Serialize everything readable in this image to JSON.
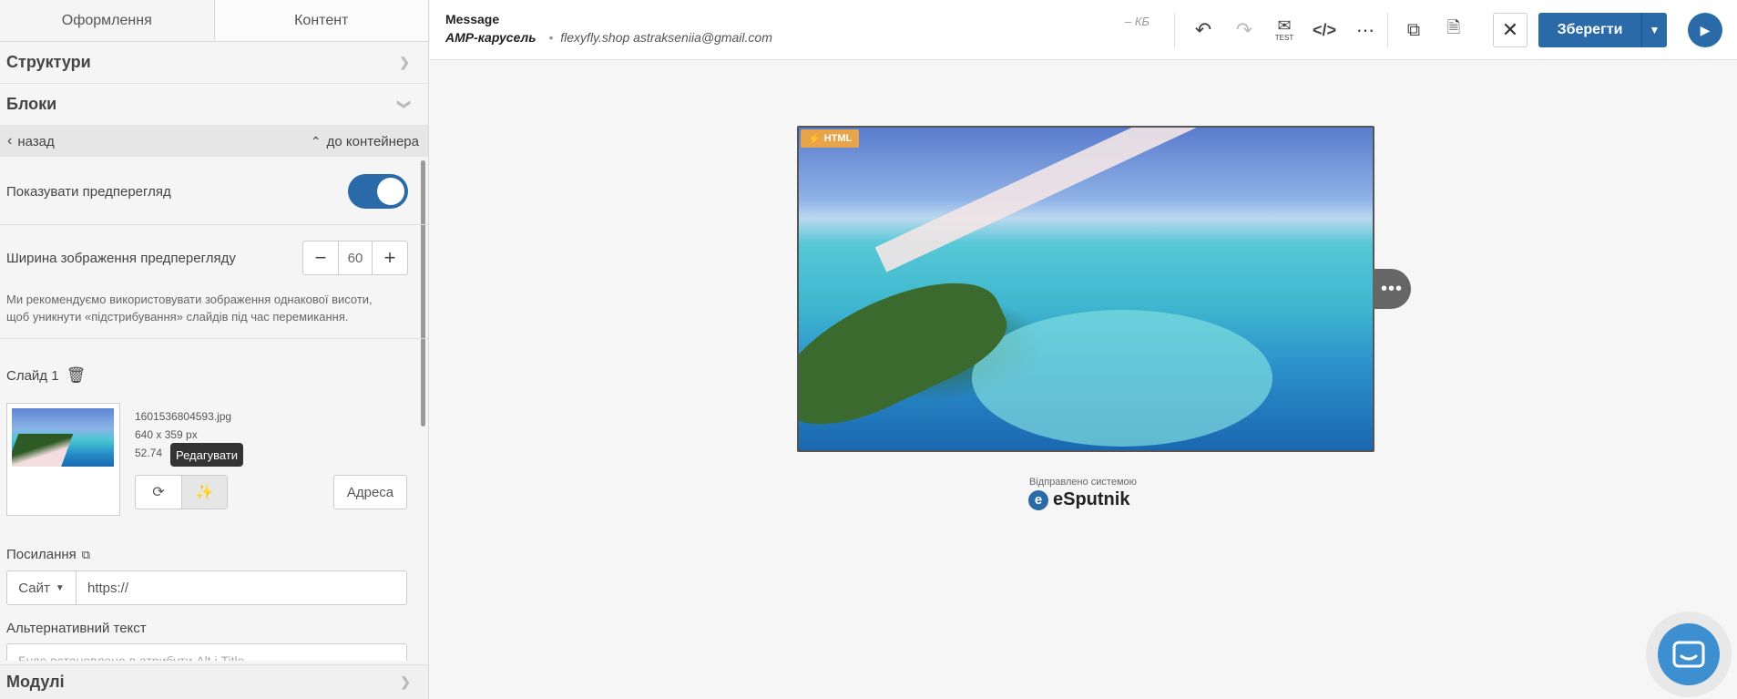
{
  "left_panel": {
    "tabs": [
      "Оформлення",
      "Контент"
    ],
    "structures_label": "Структури",
    "blocks_label": "Блоки",
    "back_label": "назад",
    "container_label": "до контейнера",
    "preview_label": "Показувати предперегляд",
    "preview_enabled": true,
    "preview_width_label": "Ширина зображення предперегляду",
    "preview_width_value": "60",
    "hint_text": "Ми рекомендуємо використовувати зображення однакової висоти, щоб уникнути «підстрибування» слайдів під час перемикання.",
    "slide": {
      "title": "Слайд 1",
      "file_name": "1601536804593.jpg",
      "dimensions": "640 x 359 px",
      "size_fragment": "52.74",
      "tooltip": "Редагувати",
      "address_button": "Адреса"
    },
    "link": {
      "label": "Посилання",
      "type_select": "Сайт",
      "url_value": "https://"
    },
    "alt_text": {
      "label": "Альтернативний текст",
      "placeholder": "Буде встановлено в атрибути Alt і Title"
    },
    "modules_label": "Модулі"
  },
  "topbar": {
    "title": "Message",
    "subtitle_bold": "АМР-карусель",
    "subtitle_rest": "flexyfly.shop astrakseniia@gmail.com",
    "size_label": "– КБ",
    "test_label": "TEST",
    "save_label": "Зберегти"
  },
  "canvas": {
    "badge_label": "HTML",
    "sent_by": "Відправлено системою",
    "brand": "eSputnik"
  },
  "colors": {
    "accent": "#2b6aa9",
    "badge": "#e8a44a"
  }
}
